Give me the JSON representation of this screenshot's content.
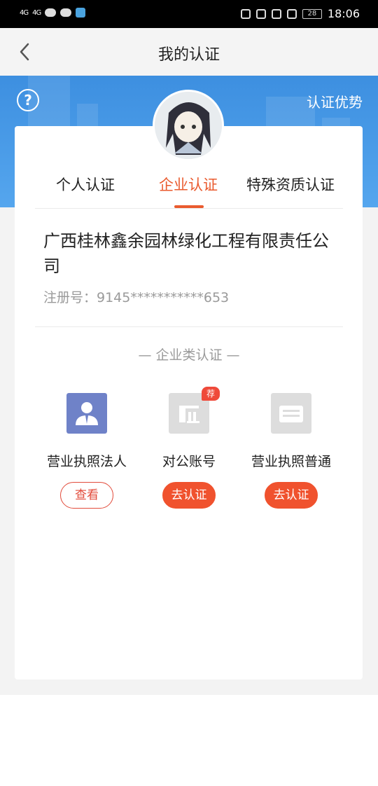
{
  "status_bar": {
    "signal_1": "4G",
    "signal_2": "4G",
    "battery": "28",
    "time": "18:06"
  },
  "nav": {
    "title": "我的认证"
  },
  "banner": {
    "help_symbol": "?",
    "advantage_link": "认证优势"
  },
  "tabs": [
    {
      "label": "个人认证"
    },
    {
      "label": "企业认证",
      "active": true
    },
    {
      "label": "特殊资质认证"
    }
  ],
  "company": {
    "name": "广西桂林鑫余园林绿化工程有限责任公司",
    "registration": "注册号：9145***********653"
  },
  "section": {
    "title": "— 企业类认证 —"
  },
  "certifications": [
    {
      "label": "营业执照法人",
      "button": "查看",
      "icon": "person-card-icon",
      "color": "#6f82c8"
    },
    {
      "label": "对公账号",
      "button": "去认证",
      "icon": "bank-icon",
      "badge": "荐",
      "color": "#dddddd"
    },
    {
      "label": "营业执照普通",
      "button": "去认证",
      "icon": "license-icon",
      "color": "#dddddd"
    }
  ],
  "colors": {
    "accent": "#ea5b2f",
    "banner": "#4a9ae8"
  }
}
